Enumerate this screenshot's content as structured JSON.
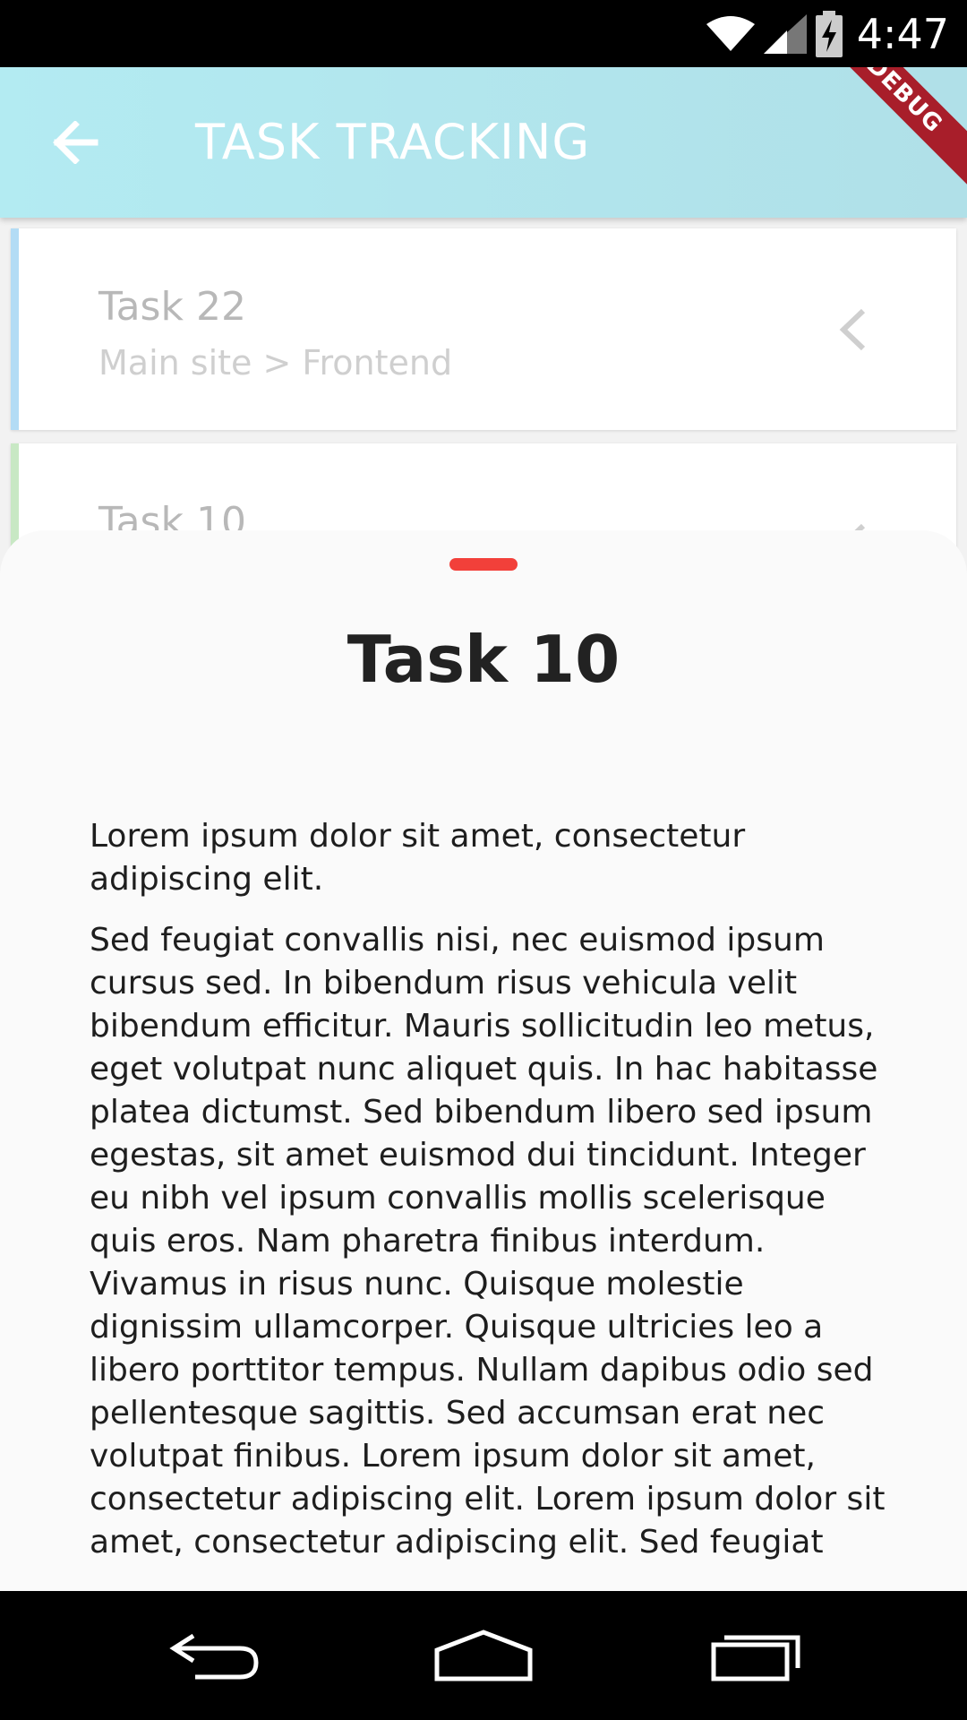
{
  "status_bar": {
    "time": "4:47",
    "icons": [
      "wifi-icon",
      "cell-signal-icon",
      "battery-charging-icon"
    ]
  },
  "app_bar": {
    "back_icon": "arrow-left-icon",
    "title": "TASK TRACKING",
    "debug_banner": "DEBUG"
  },
  "tasks": [
    {
      "name": "Task 22",
      "path": "Main site > Frontend",
      "accent": "#b3dcf5"
    },
    {
      "name": "Task 10",
      "path": "",
      "accent": "#c8e8c4"
    }
  ],
  "sheet": {
    "title": "Task 10",
    "paragraphs": [
      "Lorem ipsum dolor sit amet, consectetur adipiscing elit.",
      "Sed feugiat convallis nisi, nec euismod ipsum cursus sed. In bibendum risus vehicula velit bibendum efficitur. Mauris sollicitudin leo metus, eget volutpat nunc aliquet quis. In hac habitasse platea dictumst. Sed bibendum libero sed ipsum egestas, sit amet euismod dui tincidunt. Integer eu nibh vel ipsum convallis mollis scelerisque quis eros. Nam pharetra finibus interdum. Vivamus in risus nunc. Quisque molestie dignissim ullamcorper. Quisque ultricies leo a libero porttitor tempus. Nullam dapibus odio sed pellentesque sagittis. Sed accumsan erat nec volutpat finibus. Lorem ipsum dolor sit amet, consectetur adipiscing elit. Lorem ipsum dolor sit amet, consectetur adipiscing elit. Sed feugiat"
    ],
    "handle_color": "#f2403a"
  },
  "nav_bar": {
    "buttons": [
      "back-nav-icon",
      "home-nav-icon",
      "recents-nav-icon"
    ]
  }
}
